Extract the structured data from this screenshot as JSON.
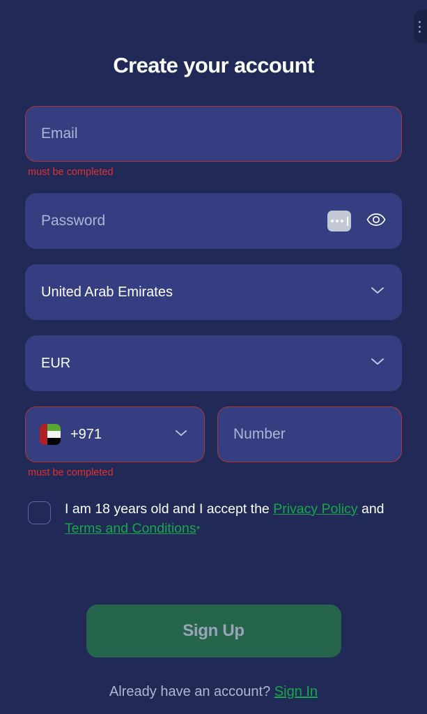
{
  "corner_panel": {
    "icon": "vertical-dots-icon"
  },
  "header": {
    "title": "Create your account"
  },
  "form": {
    "email": {
      "placeholder": "Email",
      "value": "",
      "error": "must be completed",
      "has_error": true
    },
    "password": {
      "placeholder": "Password",
      "value": "",
      "autofill_icon": "password-autofill-icon",
      "reveal_icon": "eye-icon"
    },
    "country": {
      "value": "United Arab Emirates",
      "chevron_icon": "chevron-down-icon"
    },
    "currency": {
      "value": "EUR",
      "chevron_icon": "chevron-down-icon"
    },
    "phone_code": {
      "value": "+971",
      "flag_icon": "uae-flag-icon",
      "chevron_icon": "chevron-down-icon",
      "has_error": true
    },
    "phone_number": {
      "placeholder": "Number",
      "value": "",
      "has_error": true
    },
    "phone_error": "must be completed",
    "terms": {
      "checked": false,
      "text_before": "I am 18 years old and I accept the ",
      "privacy_link": "Privacy Policy",
      "text_middle": " and ",
      "terms_link": "Terms and Conditions",
      "required_marker": "*"
    },
    "submit_label": "Sign Up"
  },
  "footer": {
    "prompt": "Already have an account? ",
    "signin_link": "Sign In"
  },
  "colors": {
    "background": "#212a57",
    "field": "#343e80",
    "error": "#e03030",
    "error_border": "#b33434",
    "link_green": "#17a64a",
    "button_green": "#24654c",
    "placeholder": "#aeb6d6"
  }
}
